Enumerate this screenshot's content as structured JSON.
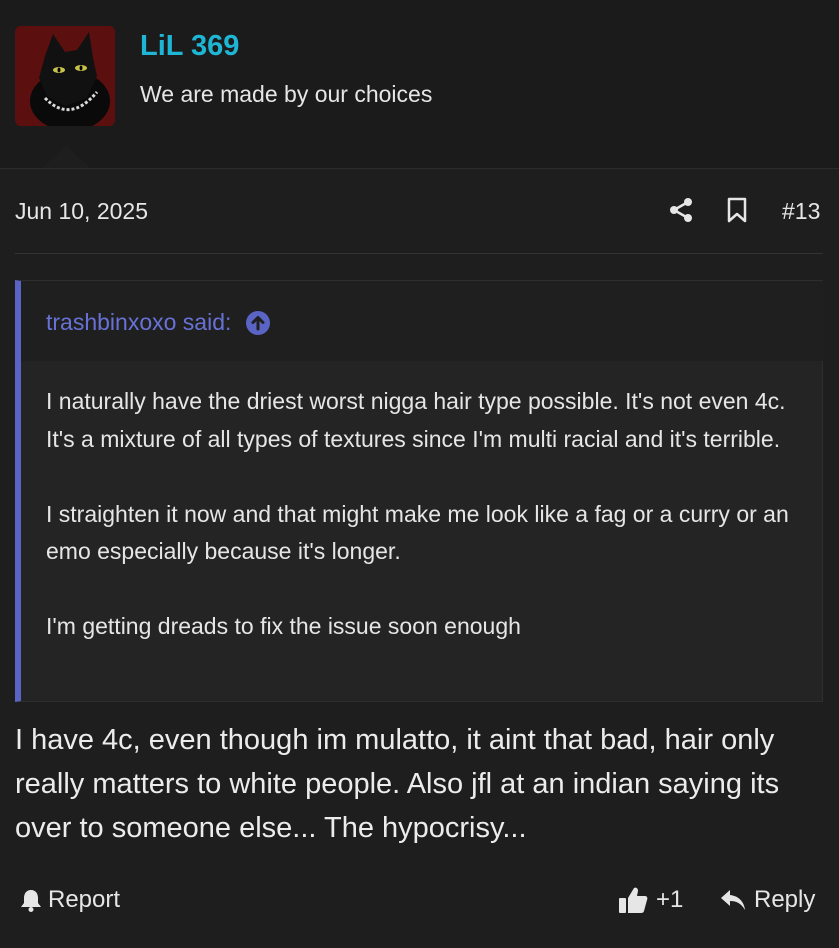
{
  "user": {
    "name": "LiL 369",
    "title": "We are made by our choices",
    "avatar_icon": "black-cat-avatar",
    "name_color": "#1fb6d6"
  },
  "post": {
    "date": "Jun 10, 2025",
    "number": "#13",
    "share_icon": "share-icon",
    "bookmark_icon": "bookmark-icon"
  },
  "quote": {
    "author": "trashbinxoxo said:",
    "author_color": "#6872d6",
    "paragraphs": [
      "I naturally have the driest worst nigga hair type possible. It's not even 4c. It's a mixture of all types of textures since I'm multi racial and it's terrible.",
      "I straighten it now and that might make me look like a fag or a curry or an emo especially because it's longer.",
      "I'm getting dreads to fix the issue soon enough"
    ]
  },
  "message": {
    "text": "I have 4c, even though im mulatto, it aint that bad, hair only really matters to white people. Also jfl at an indian saying its over to someone else... The hypocrisy..."
  },
  "footer": {
    "report_label": "Report",
    "like_count": "+1",
    "reply_label": "Reply"
  }
}
